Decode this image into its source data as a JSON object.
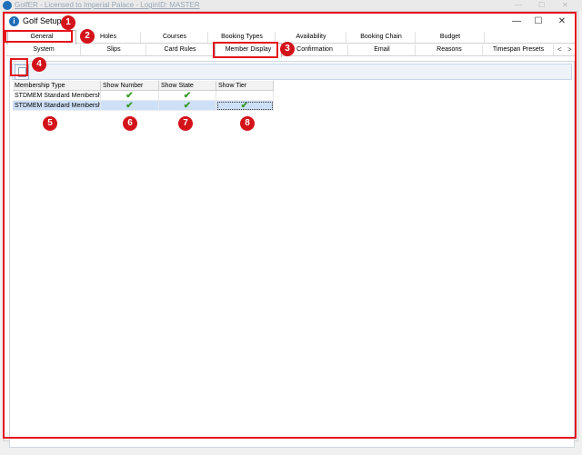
{
  "background_window": {
    "title": "GolfER - Licensed to Imperial Palace - LoginID: MASTER",
    "controls": [
      "—",
      "☐",
      "✕"
    ]
  },
  "dialog": {
    "title": "Golf Setup",
    "icon_glyph": "i",
    "controls": {
      "minimize": "—",
      "maximize": "☐",
      "close": "✕"
    }
  },
  "tabs_row1": [
    "General",
    "Holes",
    "Courses",
    "Booking Types",
    "Availability",
    "Booking Chain",
    "Budget"
  ],
  "tabs_row2": [
    "System",
    "Slips",
    "Card Rules",
    "Member Display",
    "Confirmation",
    "Email",
    "Reasons",
    "Timespan Presets"
  ],
  "tab_scroll": {
    "left": "<",
    "right": ">"
  },
  "active_tab_row1": "General",
  "active_tab_row2": "Member Display",
  "grid": {
    "columns": [
      "Membership Type",
      "Show Number",
      "Show State",
      "Show Tier"
    ],
    "rows": [
      {
        "type": "STDMEM Standard Membership",
        "show_number": "✔",
        "show_state": "✔",
        "show_tier": ""
      },
      {
        "type": "STDMEM Standard Membership",
        "show_number": "✔",
        "show_state": "✔",
        "show_tier": "✔"
      }
    ]
  },
  "annotations": [
    "1",
    "2",
    "3",
    "4",
    "5",
    "6",
    "7",
    "8"
  ],
  "annotation_color": "#d3121a"
}
